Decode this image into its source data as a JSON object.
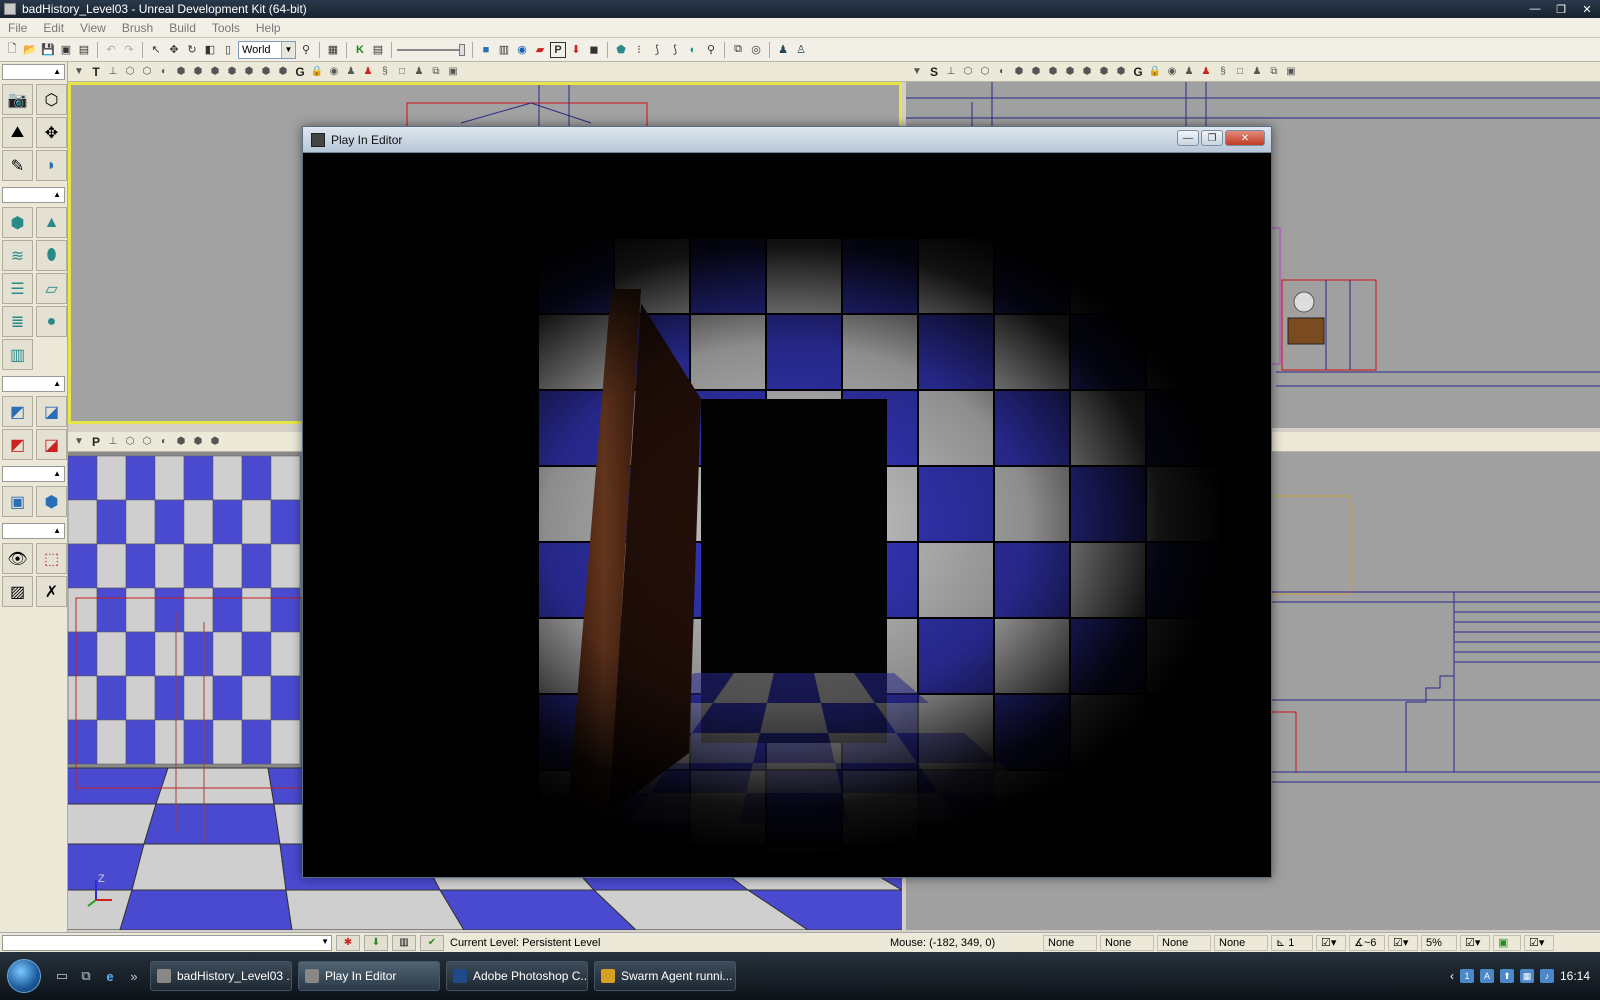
{
  "window": {
    "title": "badHistory_Level03 - Unreal Development Kit (64-bit)",
    "min": "—",
    "max": "❐",
    "close": "✕"
  },
  "menu": {
    "items": [
      "File",
      "Edit",
      "View",
      "Brush",
      "Build",
      "Tools",
      "Help"
    ]
  },
  "toolbar": {
    "coordinate_system": "World"
  },
  "viewports": {
    "top_label": "T",
    "right_label": "S",
    "perspective_label": "P",
    "realtime_label": "G",
    "axis_z": "Z"
  },
  "pie": {
    "title": "Play In Editor",
    "scene": {
      "checker_colors": [
        "#3a3cd0",
        "#d8d8d8"
      ],
      "door_color": "#6a321b"
    }
  },
  "status": {
    "current_level": "Current Level:  Persistent Level",
    "mouse": "Mouse: (-182, 349, 0)",
    "slots": [
      "None",
      "None",
      "None",
      "None"
    ],
    "grid_value": "1",
    "angle_value": "~6",
    "scale_value": "5%"
  },
  "taskbar": {
    "tasks": [
      {
        "label": "badHistory_Level03 ...",
        "active": false
      },
      {
        "label": "Play In Editor",
        "active": true
      },
      {
        "label": "Adobe Photoshop C...",
        "active": false
      },
      {
        "label": "Swarm Agent runni...",
        "active": false
      }
    ],
    "clock": "16:14"
  }
}
